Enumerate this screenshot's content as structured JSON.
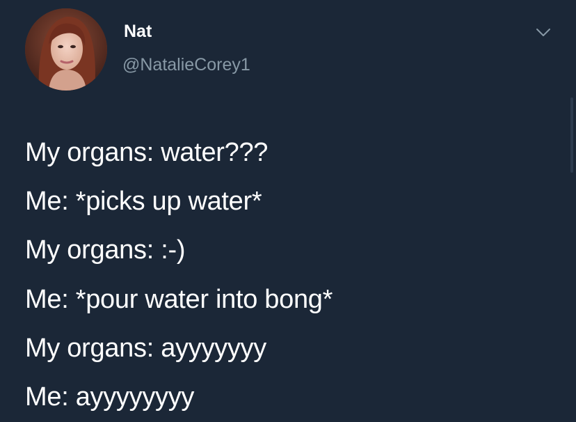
{
  "tweet": {
    "author": {
      "display_name": "Nat",
      "handle": "@NatalieCorey1",
      "avatar_icon": "profile-photo"
    },
    "menu_icon": "chevron-down-icon",
    "lines": [
      "My organs: water???",
      "Me: *picks up water*",
      "My organs: :-)",
      "Me: *pour water into bong*",
      "My organs: ayyyyyyy",
      "Me: ayyyyyyyy"
    ]
  },
  "colors": {
    "background": "#1b2737",
    "text": "#ffffff",
    "secondary_text": "#8899a6"
  }
}
